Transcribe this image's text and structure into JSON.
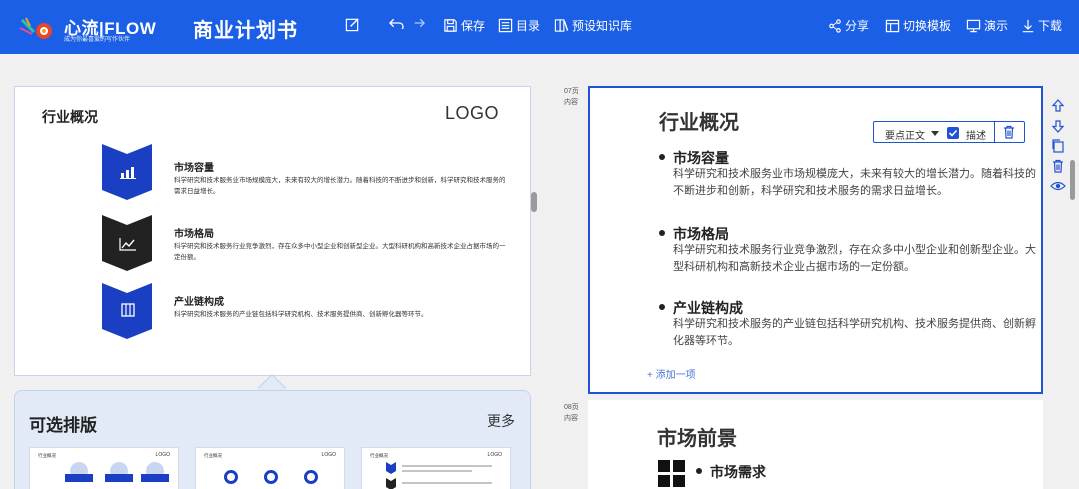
{
  "app": {
    "brand": "心流|FLOW",
    "brand_tagline": "成为你最喜爱的写作伙伴",
    "doc_title": "商业计划书"
  },
  "toolbar": {
    "save": "保存",
    "toc": "目录",
    "kb": "预设知识库",
    "share": "分享",
    "switch_template": "切换模板",
    "present": "演示",
    "download": "下载"
  },
  "left_slide": {
    "title": "行业概况",
    "logo": "LOGO",
    "items": [
      {
        "title": "市场容量",
        "text": "科学研究和技术服务业市场规模庞大，未来有较大的增长潜力。随着科技的不断进步和创新，科学研究和技术服务的需求日益增长。",
        "icon": "bar-chart-icon"
      },
      {
        "title": "市场格局",
        "text": "科学研究和技术服务行业竞争激烈，存在众多中小型企业和创新型企业。大型科研机构和高新技术企业占据市场的一定份额。",
        "icon": "line-chart-icon"
      },
      {
        "title": "产业链构成",
        "text": "科学研究和技术服务的产业链包括科学研究机构、技术服务提供商、创新孵化器等环节。",
        "icon": "building-icon"
      }
    ]
  },
  "layout_panel": {
    "title": "可选排版",
    "more": "更多",
    "thumbs": [
      {
        "title": "行业概况",
        "logo": "LOGO"
      },
      {
        "title": "行业概况",
        "logo": "LOGO"
      },
      {
        "title": "行业概况",
        "logo": "LOGO"
      }
    ]
  },
  "pages": [
    {
      "num": "07页",
      "label": "内容"
    },
    {
      "num": "08页",
      "label": "内容"
    }
  ],
  "right_slide": {
    "title": "行业概况",
    "items": [
      {
        "title": "市场容量",
        "text": "科学研究和技术服务业市场规模庞大，未来有较大的增长潜力。随着科技的不断进步和创新，科学研究和技术服务的需求日益增长。"
      },
      {
        "title": "市场格局",
        "text": "科学研究和技术服务行业竞争激烈，存在众多中小型企业和创新型企业。大型科研机构和高新技术企业占据市场的一定份额。"
      },
      {
        "title": "产业链构成",
        "text": "科学研究和技术服务的产业链包括科学研究机构、技术服务提供商、创新孵化器等环节。"
      }
    ],
    "add_item": "+ 添加一项",
    "float_bar": {
      "select": "要点正文",
      "check_label": "描述"
    }
  },
  "right_slide2": {
    "title": "市场前景",
    "item_title": "市场需求"
  },
  "colors": {
    "brand": "#1a5fe6",
    "accent": "#2152d6",
    "chevron_blue": "#1a3fc2",
    "chevron_dark": "#222222"
  }
}
